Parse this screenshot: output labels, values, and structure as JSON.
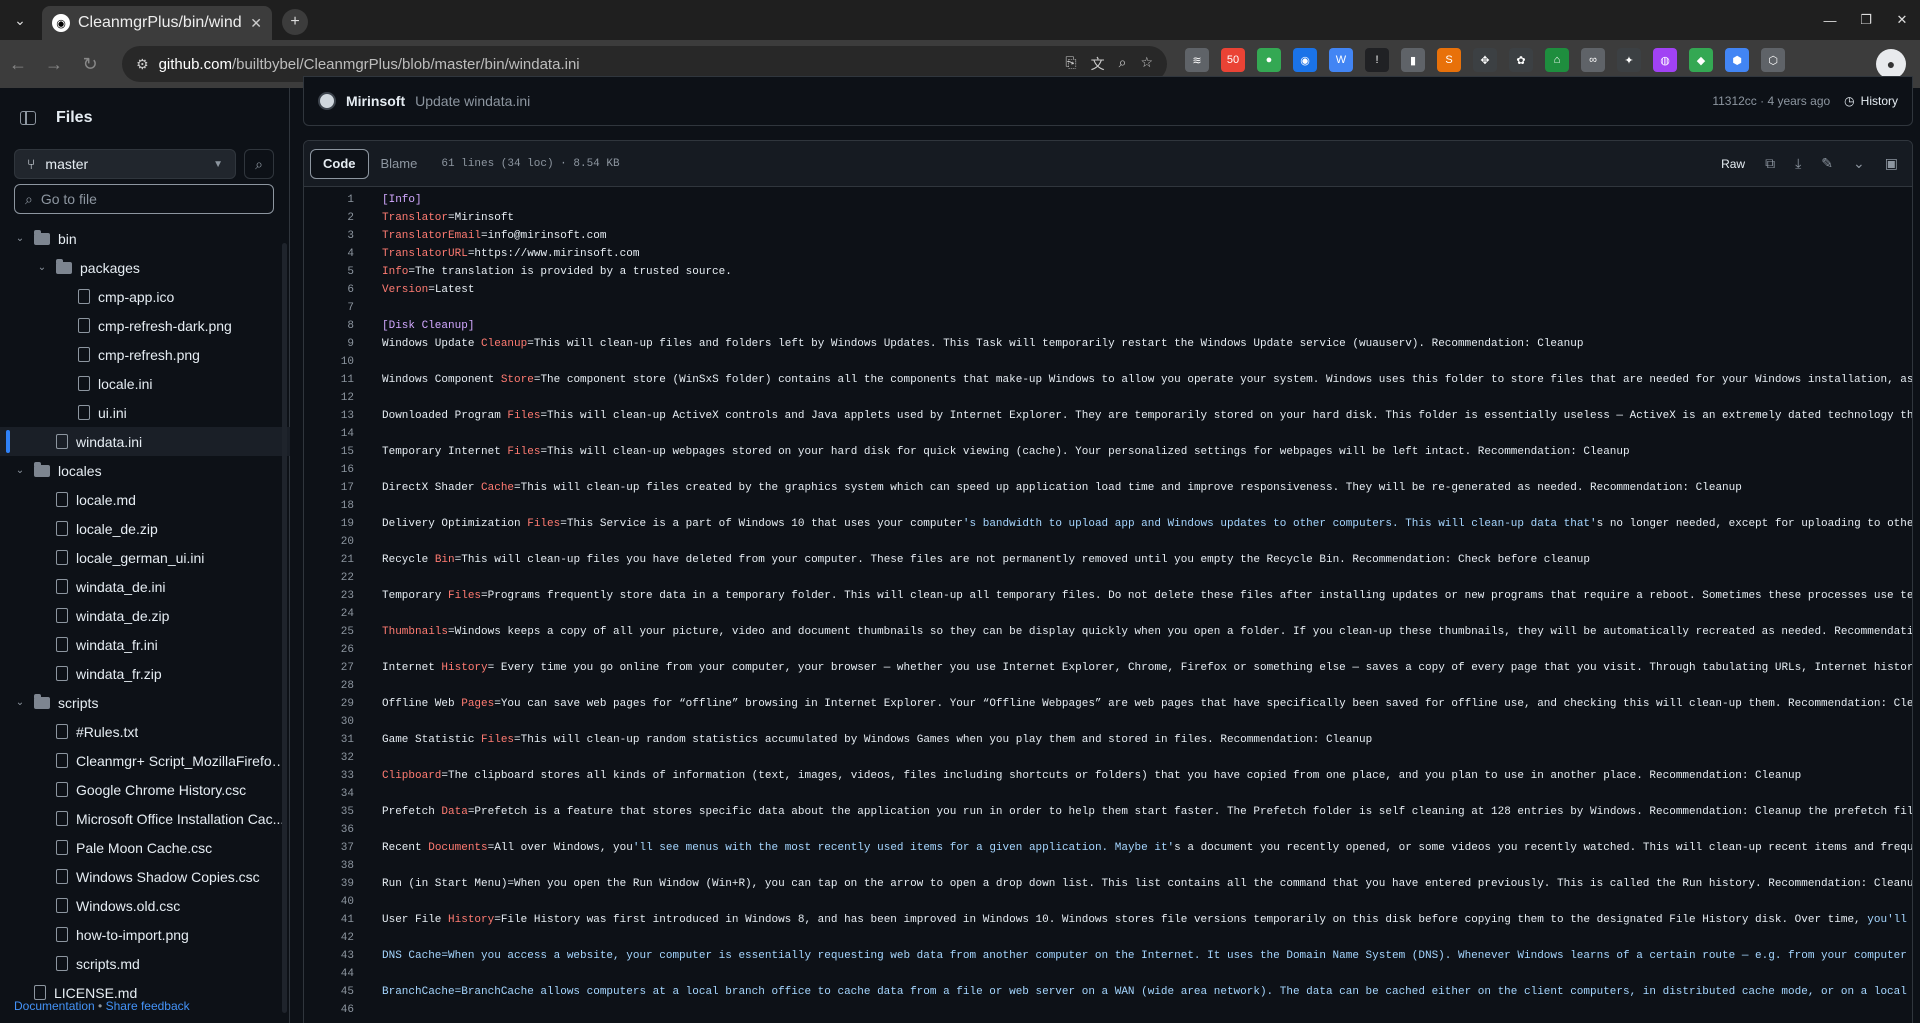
{
  "browser": {
    "tab_title": "CleanmgrPlus/bin/windata.ini",
    "url_domain": "github.com",
    "url_path": "/builtbybel/CleanmgrPlus/blob/master/bin/windata.ini",
    "extensions": [
      {
        "name": "ext-1",
        "color": "#5f6368",
        "label": "≋"
      },
      {
        "name": "ext-2",
        "color": "#ea4335",
        "label": "50"
      },
      {
        "name": "ext-3",
        "color": "#34a853",
        "label": "●"
      },
      {
        "name": "ext-4",
        "color": "#1a73e8",
        "label": "◉"
      },
      {
        "name": "ext-5",
        "color": "#4285f4",
        "label": "W"
      },
      {
        "name": "ext-6",
        "color": "#202124",
        "label": "!"
      },
      {
        "name": "ext-7",
        "color": "#5f6368",
        "label": "▮"
      },
      {
        "name": "ext-8",
        "color": "#e8710a",
        "label": "S"
      },
      {
        "name": "ext-9",
        "color": "#3c4043",
        "label": "✥"
      },
      {
        "name": "ext-10",
        "color": "#3c4043",
        "label": "✿"
      },
      {
        "name": "ext-11",
        "color": "#1e8e3e",
        "label": "⌂"
      },
      {
        "name": "ext-12",
        "color": "#5f6368",
        "label": "∞"
      },
      {
        "name": "ext-13",
        "color": "#3c4043",
        "label": "✦"
      },
      {
        "name": "ext-14",
        "color": "#a142f4",
        "label": "◍"
      },
      {
        "name": "ext-15",
        "color": "#34a853",
        "label": "◆"
      },
      {
        "name": "ext-16",
        "color": "#4285f4",
        "label": "⬢"
      },
      {
        "name": "ext-17",
        "color": "#5f6368",
        "label": "⬡"
      }
    ]
  },
  "sidebar": {
    "title": "Files",
    "branch": "master",
    "goto_placeholder": "Go to file",
    "tree": [
      {
        "label": "bin",
        "type": "folder",
        "depth": 0,
        "expanded": true
      },
      {
        "label": "packages",
        "type": "folder",
        "depth": 1,
        "expanded": true
      },
      {
        "label": "cmp-app.ico",
        "type": "file",
        "depth": 2
      },
      {
        "label": "cmp-refresh-dark.png",
        "type": "file",
        "depth": 2
      },
      {
        "label": "cmp-refresh.png",
        "type": "file",
        "depth": 2
      },
      {
        "label": "locale.ini",
        "type": "file",
        "depth": 2
      },
      {
        "label": "ui.ini",
        "type": "file",
        "depth": 2
      },
      {
        "label": "windata.ini",
        "type": "file",
        "depth": 1,
        "selected": true
      },
      {
        "label": "locales",
        "type": "folder",
        "depth": 0,
        "expanded": true
      },
      {
        "label": "locale.md",
        "type": "file",
        "depth": 1
      },
      {
        "label": "locale_de.zip",
        "type": "file",
        "depth": 1
      },
      {
        "label": "locale_german_ui.ini",
        "type": "file",
        "depth": 1
      },
      {
        "label": "windata_de.ini",
        "type": "file",
        "depth": 1
      },
      {
        "label": "windata_de.zip",
        "type": "file",
        "depth": 1
      },
      {
        "label": "windata_fr.ini",
        "type": "file",
        "depth": 1
      },
      {
        "label": "windata_fr.zip",
        "type": "file",
        "depth": 1
      },
      {
        "label": "scripts",
        "type": "folder",
        "depth": 0,
        "expanded": true
      },
      {
        "label": "#Rules.txt",
        "type": "file",
        "depth": 1
      },
      {
        "label": "Cleanmgr+ Script_MozillaFirefox...",
        "type": "file",
        "depth": 1
      },
      {
        "label": "Google Chrome History.csc",
        "type": "file",
        "depth": 1
      },
      {
        "label": "Microsoft Office Installation Cac...",
        "type": "file",
        "depth": 1
      },
      {
        "label": "Pale Moon Cache.csc",
        "type": "file",
        "depth": 1
      },
      {
        "label": "Windows Shadow Copies.csc",
        "type": "file",
        "depth": 1
      },
      {
        "label": "Windows.old.csc",
        "type": "file",
        "depth": 1
      },
      {
        "label": "how-to-import.png",
        "type": "file",
        "depth": 1
      },
      {
        "label": "scripts.md",
        "type": "file",
        "depth": 1
      },
      {
        "label": "LICENSE.md",
        "type": "file",
        "depth": 0
      }
    ],
    "footer_doc": "Documentation",
    "footer_sep": " • ",
    "footer_feedback": "Share feedback"
  },
  "commit": {
    "author": "Mirinsoft",
    "message": "Update windata.ini",
    "sha_age": "11312cc · 4 years ago",
    "history_label": "History"
  },
  "file": {
    "tab_code": "Code",
    "tab_blame": "Blame",
    "meta": "61 lines (34 loc) · 8.54 KB",
    "raw_label": "Raw",
    "lines": [
      {
        "n": "1",
        "parts": [
          [
            "s",
            "[Info]"
          ]
        ]
      },
      {
        "n": "2",
        "parts": [
          [
            "k",
            "Translator"
          ],
          [
            "t",
            "=Mirinsoft"
          ]
        ]
      },
      {
        "n": "3",
        "parts": [
          [
            "k",
            "TranslatorEmail"
          ],
          [
            "t",
            "=info@mirinsoft.com"
          ]
        ]
      },
      {
        "n": "4",
        "parts": [
          [
            "k",
            "TranslatorURL"
          ],
          [
            "t",
            "=https://www.mirinsoft.com"
          ]
        ]
      },
      {
        "n": "5",
        "parts": [
          [
            "k",
            "Info"
          ],
          [
            "t",
            "=The translation is provided by a trusted source."
          ]
        ]
      },
      {
        "n": "6",
        "parts": [
          [
            "k",
            "Version"
          ],
          [
            "t",
            "=Latest"
          ]
        ]
      },
      {
        "n": "7",
        "parts": []
      },
      {
        "n": "8",
        "parts": [
          [
            "s",
            "[Disk Cleanup]"
          ]
        ]
      },
      {
        "n": "9",
        "parts": [
          [
            "t",
            "Windows Update "
          ],
          [
            "k",
            "Cleanup"
          ],
          [
            "t",
            "=This will clean-up files and folders left by Windows Updates. This Task will temporarily restart the Windows Update service (wuauserv). Recommendation: Cleanup"
          ]
        ]
      },
      {
        "n": "10",
        "parts": []
      },
      {
        "n": "11",
        "parts": [
          [
            "t",
            "Windows Component "
          ],
          [
            "k",
            "Store"
          ],
          [
            "t",
            "=The component store (WinSxS folder) contains all the components that make-up Windows to allow you operate your system. Windows uses this folder to store files that are needed for your Windows installation, as w"
          ]
        ]
      },
      {
        "n": "12",
        "parts": []
      },
      {
        "n": "13",
        "parts": [
          [
            "t",
            "Downloaded Program "
          ],
          [
            "k",
            "Files"
          ],
          [
            "t",
            "=This will clean-up ActiveX controls and Java applets used by Internet Explorer. They are temporarily stored on your hard disk. This folder is essentially useless — ActiveX is an extremely dated technology that"
          ]
        ]
      },
      {
        "n": "14",
        "parts": []
      },
      {
        "n": "15",
        "parts": [
          [
            "t",
            "Temporary Internet "
          ],
          [
            "k",
            "Files"
          ],
          [
            "t",
            "=This will clean-up webpages stored on your hard disk for quick viewing (cache). Your personalized settings for webpages will be left intact. Recommendation: Cleanup"
          ]
        ]
      },
      {
        "n": "16",
        "parts": []
      },
      {
        "n": "17",
        "parts": [
          [
            "t",
            "DirectX Shader "
          ],
          [
            "k",
            "Cache"
          ],
          [
            "t",
            "=This will clean-up files created by the graphics system which can speed up application load time and improve responsiveness. They will be re-generated as needed. Recommendation: Cleanup"
          ]
        ]
      },
      {
        "n": "18",
        "parts": []
      },
      {
        "n": "19",
        "parts": [
          [
            "t",
            "Delivery Optimization "
          ],
          [
            "k",
            "Files"
          ],
          [
            "t",
            "=This Service is a part of Windows 10 that uses your computer"
          ],
          [
            "b",
            "'s bandwidth to upload app and Windows updates to other computers. This will clean-up data that'"
          ],
          [
            "t",
            "s no longer needed, except for uploading to other"
          ]
        ]
      },
      {
        "n": "20",
        "parts": []
      },
      {
        "n": "21",
        "parts": [
          [
            "t",
            "Recycle "
          ],
          [
            "k",
            "Bin"
          ],
          [
            "t",
            "=This will clean-up files you have deleted from your computer. These files are not permanently removed until you empty the Recycle Bin. Recommendation: Check before cleanup"
          ]
        ]
      },
      {
        "n": "22",
        "parts": []
      },
      {
        "n": "23",
        "parts": [
          [
            "t",
            "Temporary "
          ],
          [
            "k",
            "Files"
          ],
          [
            "t",
            "=Programs frequently store data in a temporary folder. This will clean-up all temporary files. Do not delete these files after installing updates or new programs that require a reboot. Sometimes these processes use temp"
          ]
        ]
      },
      {
        "n": "24",
        "parts": []
      },
      {
        "n": "25",
        "parts": [
          [
            "k",
            "Thumbnails"
          ],
          [
            "t",
            "=Windows keeps a copy of all your picture, video and document thumbnails so they can be display quickly when you open a folder. If you clean-up these thumbnails, they will be automatically recreated as needed. Recommendation"
          ]
        ]
      },
      {
        "n": "26",
        "parts": []
      },
      {
        "n": "27",
        "parts": [
          [
            "t",
            "Internet "
          ],
          [
            "k",
            "History"
          ],
          [
            "t",
            "= Every time you go online from your computer, your browser — whether you use Internet Explorer, Chrome, Firefox or something else — saves a copy of every page that you visit. Through tabulating URLs, Internet history"
          ]
        ]
      },
      {
        "n": "28",
        "parts": []
      },
      {
        "n": "29",
        "parts": [
          [
            "t",
            "Offline Web "
          ],
          [
            "k",
            "Pages"
          ],
          [
            "t",
            "=You can save web pages for “offline” browsing in Internet Explorer. Your “Offline Webpages” are web pages that have specifically been saved for offline use, and checking this will clean-up them. Recommendation: Clean"
          ]
        ]
      },
      {
        "n": "30",
        "parts": []
      },
      {
        "n": "31",
        "parts": [
          [
            "t",
            "Game Statistic "
          ],
          [
            "k",
            "Files"
          ],
          [
            "t",
            "=This will clean-up random statistics accumulated by Windows Games when you play them and stored in files. Recommendation: Cleanup"
          ]
        ]
      },
      {
        "n": "32",
        "parts": []
      },
      {
        "n": "33",
        "parts": [
          [
            "k",
            "Clipboard"
          ],
          [
            "t",
            "=The clipboard stores all kinds of information (text, images, videos, files including shortcuts or folders) that you have copied from one place, and you plan to use in another place. Recommendation: Cleanup"
          ]
        ]
      },
      {
        "n": "34",
        "parts": []
      },
      {
        "n": "35",
        "parts": [
          [
            "t",
            "Prefetch "
          ],
          [
            "k",
            "Data"
          ],
          [
            "t",
            "=Prefetch is a feature that stores specific data about the application you run in order to help them start faster. The Prefetch folder is self cleaning at 128 entries by Windows. Recommendation: Cleanup the prefetch files"
          ]
        ]
      },
      {
        "n": "36",
        "parts": []
      },
      {
        "n": "37",
        "parts": [
          [
            "t",
            "Recent "
          ],
          [
            "k",
            "Documents"
          ],
          [
            "t",
            "=All over Windows, you"
          ],
          [
            "b",
            "'ll see menus with the most recently used items for a given application. Maybe it'"
          ],
          [
            "t",
            "s a document you recently opened, or some videos you recently watched. This will clean-up recent items and frequen"
          ]
        ]
      },
      {
        "n": "38",
        "parts": []
      },
      {
        "n": "39",
        "parts": [
          [
            "t",
            "Run (in Start Menu)=When you open the Run Window (Win+R), you can tap on the arrow to open a drop down list. This list contains all the command that you have entered previously. This is called the Run history. Recommendation: Cleanup"
          ]
        ]
      },
      {
        "n": "40",
        "parts": []
      },
      {
        "n": "41",
        "parts": [
          [
            "t",
            "User File "
          ],
          [
            "k",
            "History"
          ],
          [
            "t",
            "=File History was first introduced in Windows 8, and has been improved in Windows 10. Windows stores file versions temporarily on this disk before copying them to the designated File History disk. Over time, "
          ],
          [
            "b",
            "you'll ha"
          ]
        ]
      },
      {
        "n": "42",
        "parts": []
      },
      {
        "n": "43",
        "parts": [
          [
            "b",
            "DNS Cache=When you access a website, your computer is essentially requesting web data from another computer on the Internet. It uses the Domain Name System (DNS). Whenever Windows learns of a certain route — e.g. from your computer to"
          ]
        ]
      },
      {
        "n": "44",
        "parts": []
      },
      {
        "n": "45",
        "parts": [
          [
            "b",
            "BranchCache=BranchCache allows computers at a local branch office to cache data from a file or web server on a WAN (wide area network). The data can be cached either on the client computers, in distributed cache mode, or on a local se"
          ]
        ]
      },
      {
        "n": "46",
        "parts": []
      }
    ]
  }
}
